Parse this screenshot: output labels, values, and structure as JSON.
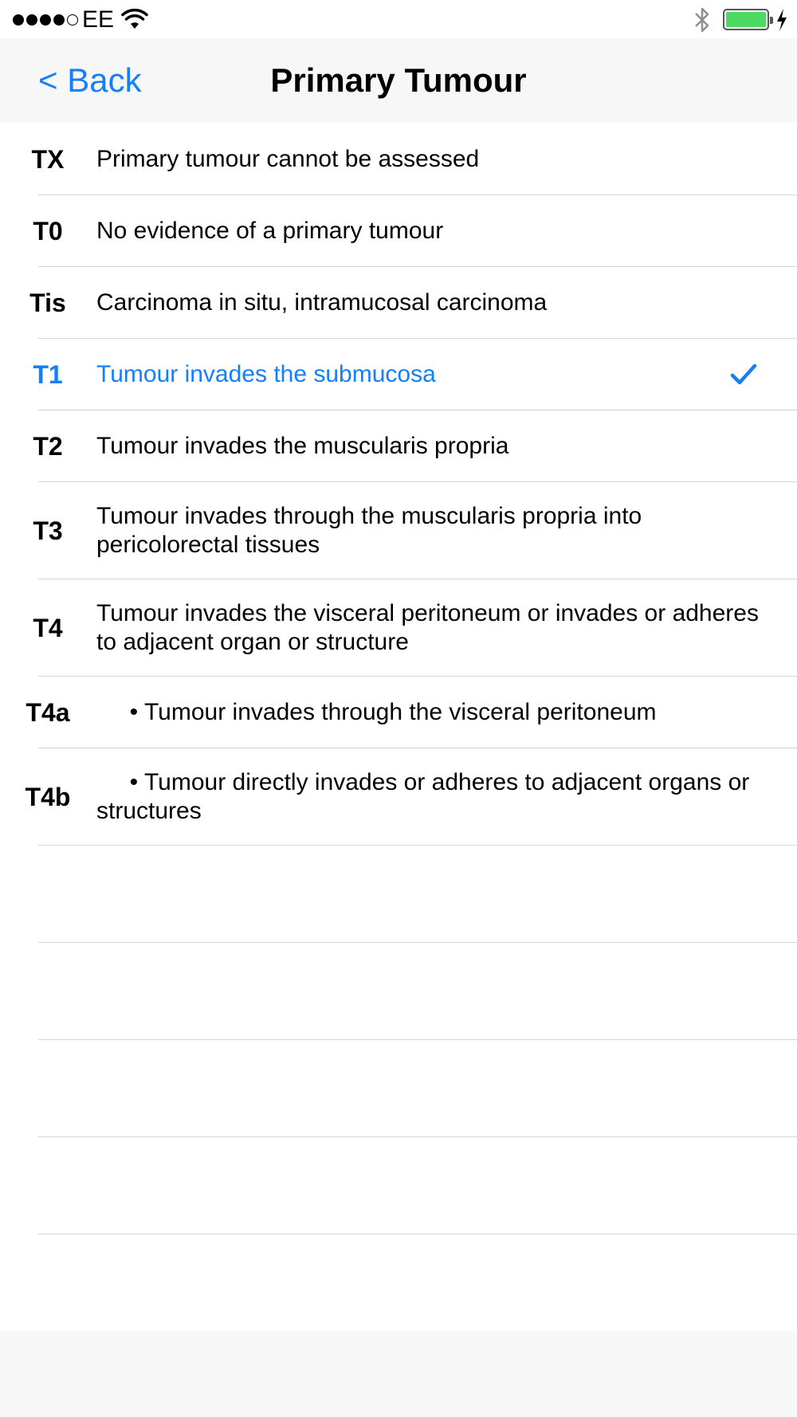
{
  "status_bar": {
    "signal_bars_filled": 4,
    "signal_bars_total": 5,
    "carrier": "EE",
    "battery_level": 1.0,
    "battery_color": "#4cd964",
    "icons": [
      "wifi-icon",
      "bluetooth-icon",
      "battery-icon",
      "charging-bolt-icon"
    ]
  },
  "nav": {
    "back_label": "< Back",
    "title": "Primary Tumour",
    "tint_color": "#157efb"
  },
  "rows": [
    {
      "code": "TX",
      "description": "Primary tumour cannot be assessed",
      "selected": false
    },
    {
      "code": "T0",
      "description": "No evidence of a primary tumour",
      "selected": false
    },
    {
      "code": "Tis",
      "description": "Carcinoma in situ, intramucosal carcinoma",
      "selected": false
    },
    {
      "code": "T1",
      "description": "Tumour invades the submucosa",
      "selected": true
    },
    {
      "code": "T2",
      "description": "Tumour invades the muscularis propria",
      "selected": false
    },
    {
      "code": "T3",
      "description": "Tumour invades through the muscularis propria into pericolorectal tissues",
      "selected": false
    },
    {
      "code": "T4",
      "description": "Tumour invades the visceral peritoneum or invades or adheres to adjacent organ or structure",
      "selected": false
    },
    {
      "code": "T4a",
      "description": "     • Tumour invades through the visceral peritoneum",
      "selected": false
    },
    {
      "code": "T4b",
      "description": "     • Tumour directly invades or adheres to adjacent organs or structures",
      "selected": false
    }
  ],
  "selection_icon": "checkmark-icon"
}
